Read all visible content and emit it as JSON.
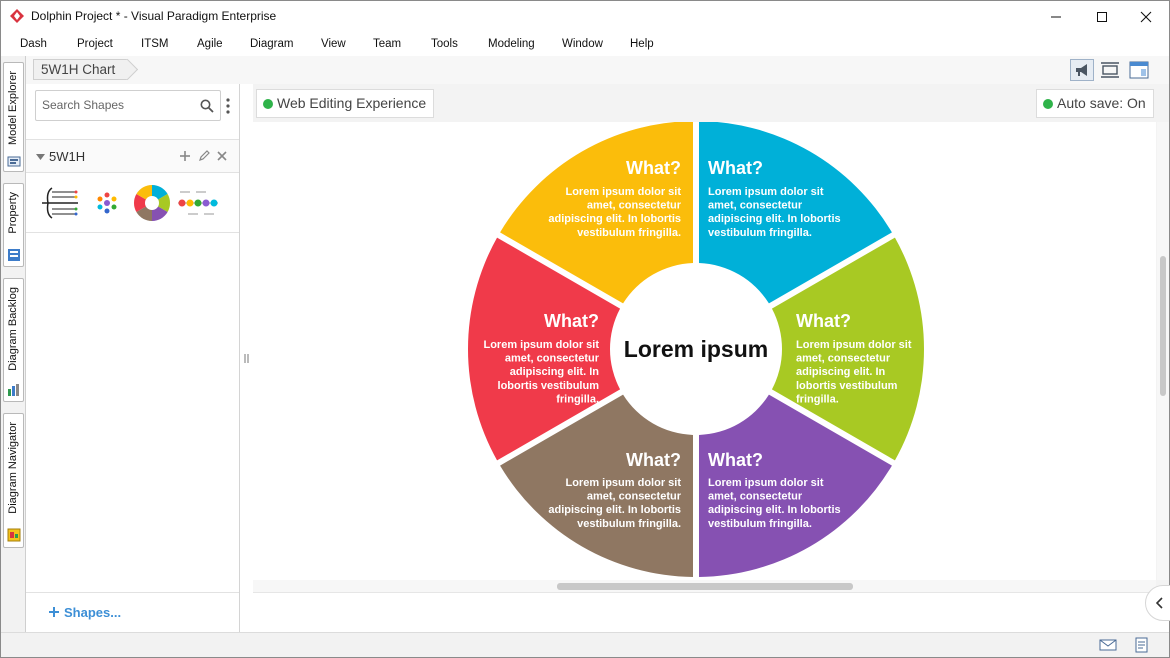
{
  "window": {
    "title": "Dolphin Project * - Visual Paradigm Enterprise",
    "controls": [
      "minimize",
      "maximize",
      "close"
    ]
  },
  "menu": [
    "Dash",
    "Project",
    "ITSM",
    "Agile",
    "Diagram",
    "View",
    "Team",
    "Tools",
    "Modeling",
    "Window",
    "Help"
  ],
  "side_tabs": [
    "Model Explorer",
    "Property",
    "Diagram Backlog",
    "Diagram Navigator"
  ],
  "breadcrumb": "5W1H Chart",
  "shapes_panel": {
    "search_placeholder": "Search Shapes",
    "category": "5W1H",
    "thumbnails": [
      "fishbone-thumbnail",
      "hub-thumbnail",
      "wheel-thumbnail",
      "timeline-thumbnail"
    ],
    "footer_link": "Shapes..."
  },
  "canvas": {
    "web_editing_label": "Web Editing Experience",
    "autosave_label": "Auto save: On"
  },
  "diagram": {
    "center_label": "Lorem ipsum",
    "segments": [
      {
        "title": "What?",
        "lines": [
          "Lorem ipsum dolor sit",
          "amet, consectetur",
          "adipiscing elit. In lobortis",
          "vestibulum fringilla."
        ],
        "color": "#00b0d8"
      },
      {
        "title": "What?",
        "lines": [
          "Lorem ipsum dolor sit",
          "amet, consectetur",
          "adipiscing elit. In",
          "lobortis vestibulum",
          "fringilla."
        ],
        "color": "#a8c923"
      },
      {
        "title": "What?",
        "lines": [
          "Lorem ipsum dolor sit",
          "amet, consectetur",
          "adipiscing elit. In lobortis",
          "vestibulum fringilla."
        ],
        "color": "#8651b2"
      },
      {
        "title": "What?",
        "lines": [
          "Lorem ipsum dolor sit",
          "amet, consectetur",
          "adipiscing elit. In lobortis",
          "vestibulum fringilla."
        ],
        "color": "#8f7762"
      },
      {
        "title": "What?",
        "lines": [
          "Lorem ipsum dolor sit",
          "amet, consectetur",
          "adipiscing elit. In",
          "lobortis vestibulum",
          "fringilla."
        ],
        "color": "#f03a4a"
      },
      {
        "title": "What?",
        "lines": [
          "Lorem ipsum dolor sit",
          "amet, consectetur",
          "adipiscing elit. In lobortis",
          "vestibulum fringilla."
        ],
        "color": "#fbbd0b"
      }
    ]
  }
}
